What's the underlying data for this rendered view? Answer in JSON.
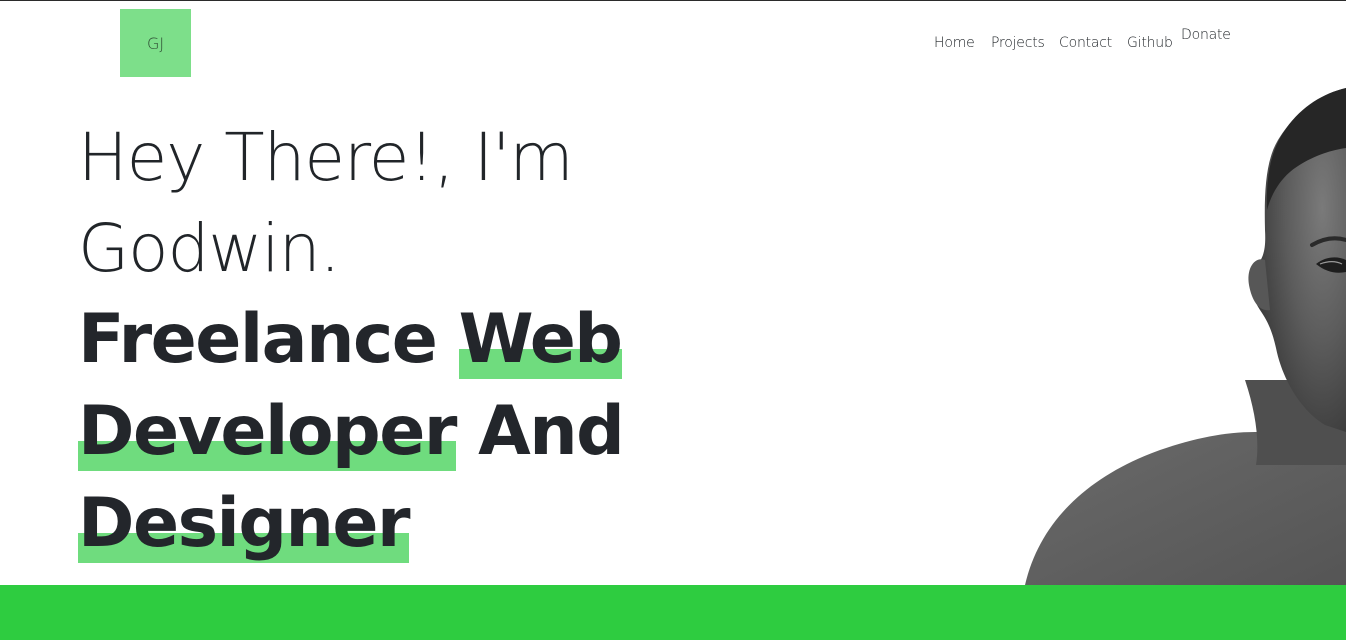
{
  "logo": {
    "text": "GJ"
  },
  "nav": {
    "items": [
      {
        "label": "Home"
      },
      {
        "label": "Projects"
      },
      {
        "label": "Contact"
      },
      {
        "label": "Github"
      },
      {
        "label": "Donate"
      }
    ]
  },
  "hero": {
    "greeting_line1": "Hey There!, I'm",
    "greeting_line2": "Godwin.",
    "role_word1": "Freelance",
    "role_word2": "Web",
    "role_word3": "Developer",
    "role_word4": "And",
    "role_word5": "Designer"
  },
  "colors": {
    "accent": "#2ecc40",
    "highlight": "#6fdc7e",
    "logo_bg": "#7ddf8a",
    "text": "#212529"
  }
}
